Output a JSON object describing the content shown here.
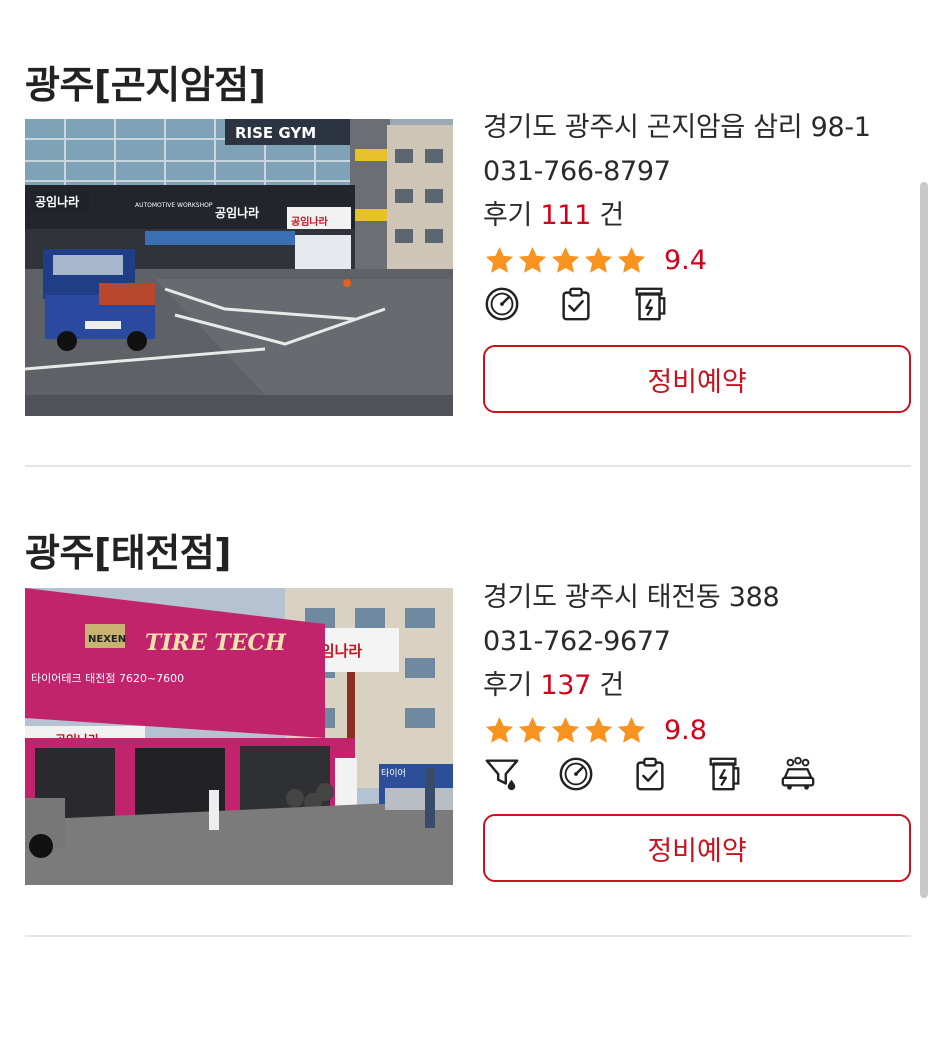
{
  "shops": [
    {
      "name": "광주[곤지암점]",
      "address": "경기도 광주시 곤지암읍 삼리 98-1",
      "phone": "031-766-8797",
      "review_prefix": "후기",
      "review_count": "111",
      "review_suffix": "건",
      "star_count": 5,
      "score": "9.4",
      "services": [
        "speedometer-icon",
        "clipboard-check-icon",
        "battery-icon"
      ],
      "button_label": "정비예약",
      "photo_signs": [
        "RISE GYM",
        "공임나라",
        "AUTOMOTIVE WORKSHOP",
        "공임나라",
        "공임나라"
      ]
    },
    {
      "name": "광주[태전점]",
      "address": "경기도 광주시 태전동 388",
      "phone": "031-762-9677",
      "review_prefix": "후기",
      "review_count": "137",
      "review_suffix": "건",
      "star_count": 5,
      "score": "9.8",
      "services": [
        "oil-filter-icon",
        "speedometer-icon",
        "clipboard-check-icon",
        "battery-icon",
        "car-wash-icon"
      ],
      "button_label": "정비예약",
      "photo_signs": [
        "NEXEN",
        "TIRE TECH",
        "타이어테크 태전점 7620~7600",
        "공임나라",
        "공임나라",
        "타이어"
      ]
    }
  ],
  "colors": {
    "accent": "#c8121e",
    "score_red": "#d0021b",
    "star": "#f7931e",
    "divider": "#e4e4e4"
  }
}
